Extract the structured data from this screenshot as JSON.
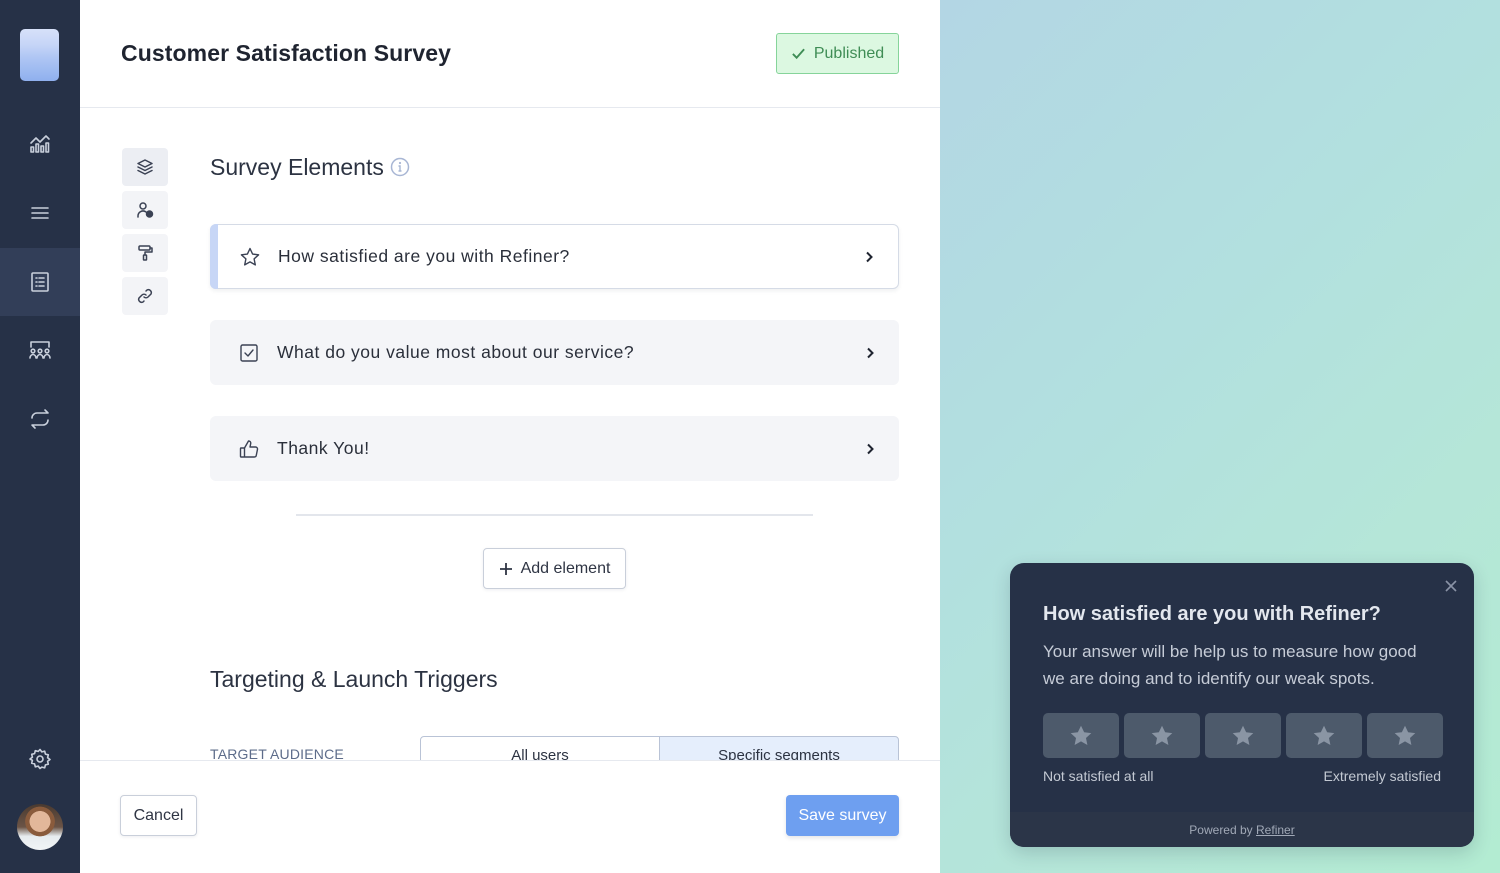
{
  "sidebar": {
    "items": [
      {
        "name": "analytics",
        "icon": "chart-icon",
        "active": false
      },
      {
        "name": "menu",
        "icon": "lines-icon",
        "active": false
      },
      {
        "name": "surveys",
        "icon": "list-icon",
        "active": true
      },
      {
        "name": "audiences",
        "icon": "users-group-icon",
        "active": false
      },
      {
        "name": "integrations",
        "icon": "sync-icon",
        "active": false
      },
      {
        "name": "settings",
        "icon": "gear-icon",
        "active": false
      }
    ]
  },
  "header": {
    "title": "Customer Satisfaction Survey",
    "status_label": "Published",
    "status_color": "#3f8d55"
  },
  "tools": [
    {
      "name": "elements",
      "icon": "layers-icon"
    },
    {
      "name": "audience",
      "icon": "user-clock-icon"
    },
    {
      "name": "design",
      "icon": "paint-roller-icon"
    },
    {
      "name": "link",
      "icon": "link-icon"
    }
  ],
  "survey_elements": {
    "title": "Survey Elements",
    "items": [
      {
        "label": "How satisfied are you with Refiner?",
        "icon": "star-icon",
        "active": true
      },
      {
        "label": "What do you value most about our service?",
        "icon": "checkbox-icon",
        "active": false
      },
      {
        "label": "Thank You!",
        "icon": "thumbs-up-icon",
        "active": false
      }
    ],
    "add_label": "Add element"
  },
  "targeting": {
    "title": "Targeting & Launch Triggers",
    "audience_label": "TARGET AUDIENCE",
    "options": [
      "All users",
      "Specific segments"
    ],
    "selected": "Specific segments"
  },
  "footer": {
    "cancel_label": "Cancel",
    "save_label": "Save survey",
    "accent": "#6e9ff0"
  },
  "widget": {
    "title": "How satisfied are you with Refiner?",
    "description": "Your answer will be help us to measure how good we are doing and to identify our weak spots.",
    "rating_count": 5,
    "low_label": "Not satisfied at all",
    "high_label": "Extremely satisfied",
    "powered_by": "Powered by",
    "brand": "Refiner"
  }
}
